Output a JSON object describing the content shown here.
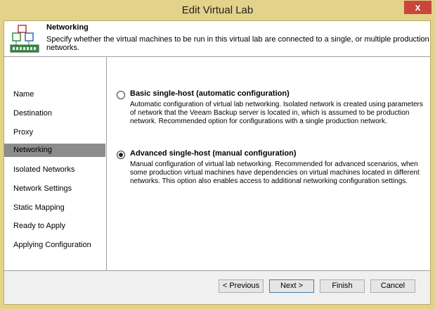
{
  "window": {
    "title": "Edit Virtual Lab",
    "close_glyph": "x"
  },
  "header": {
    "title": "Networking",
    "description": "Specify whether the virtual machines to be run in this virtual lab are connected to a single, or multiple production networks.",
    "icon": "network-icon"
  },
  "sidebar": {
    "items": [
      {
        "label": "Name",
        "active": false
      },
      {
        "label": "Destination",
        "active": false
      },
      {
        "label": "Proxy",
        "active": false
      },
      {
        "label": "Networking",
        "active": true
      },
      {
        "label": "Isolated Networks",
        "active": false
      },
      {
        "label": "Network Settings",
        "active": false
      },
      {
        "label": "Static Mapping",
        "active": false
      },
      {
        "label": "Ready to Apply",
        "active": false
      },
      {
        "label": "Applying Configuration",
        "active": false
      }
    ]
  },
  "options": [
    {
      "label": "Basic single-host (automatic configuration)",
      "description": "Automatic configuration of virtual lab networking. Isolated network is created using parameters of network that the Veeam Backup server is located in, which is assumed to be production network. Recommended option for configurations with a single production network.",
      "selected": false
    },
    {
      "label": "Advanced single-host (manual configuration)",
      "description": "Manual configuration of virtual lab networking. Recommended for advanced scenarios, when some production virtual machines have dependencies on virtual machines located in different networks. This option also enables access to additional networking configuration settings.",
      "selected": true
    }
  ],
  "buttons": {
    "previous": "< Previous",
    "next": "Next >",
    "finish": "Finish",
    "cancel": "Cancel"
  },
  "colors": {
    "title_bar": "#e3d28a",
    "close_button": "#c9463d",
    "active_step": "#8c8c8c"
  }
}
